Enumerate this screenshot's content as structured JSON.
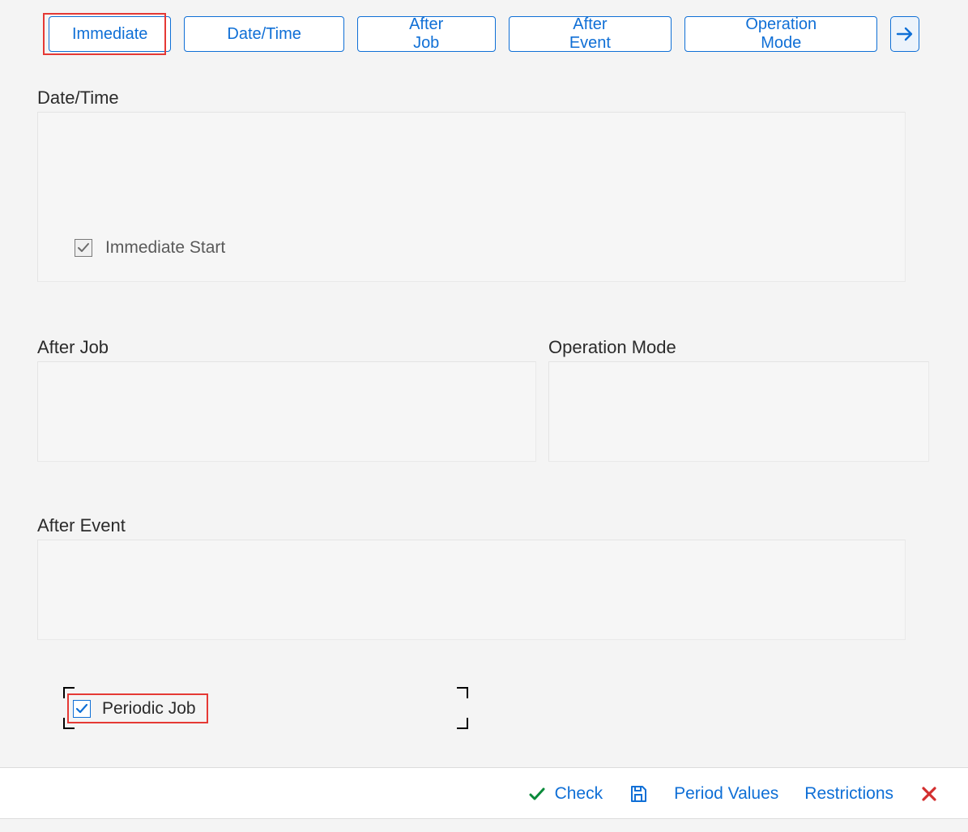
{
  "toolbar": {
    "buttons": {
      "immediate": "Immediate",
      "date_time": "Date/Time",
      "after_job": "After Job",
      "after_event": "After Event",
      "operation_mode": "Operation Mode"
    }
  },
  "sections": {
    "date_time": {
      "label": "Date/Time",
      "immediate_start": {
        "label": "Immediate Start",
        "checked": true,
        "enabled": false
      }
    },
    "after_job": {
      "label": "After Job"
    },
    "operation_mode": {
      "label": "Operation Mode"
    },
    "after_event": {
      "label": "After Event"
    }
  },
  "periodic": {
    "label": "Periodic Job",
    "checked": true
  },
  "footer": {
    "check": "Check",
    "period_values": "Period Values",
    "restrictions": "Restrictions"
  },
  "colors": {
    "accent": "#0f6fd6",
    "highlight": "#e53935",
    "success": "#0a8a3a",
    "danger": "#d32f2f"
  }
}
